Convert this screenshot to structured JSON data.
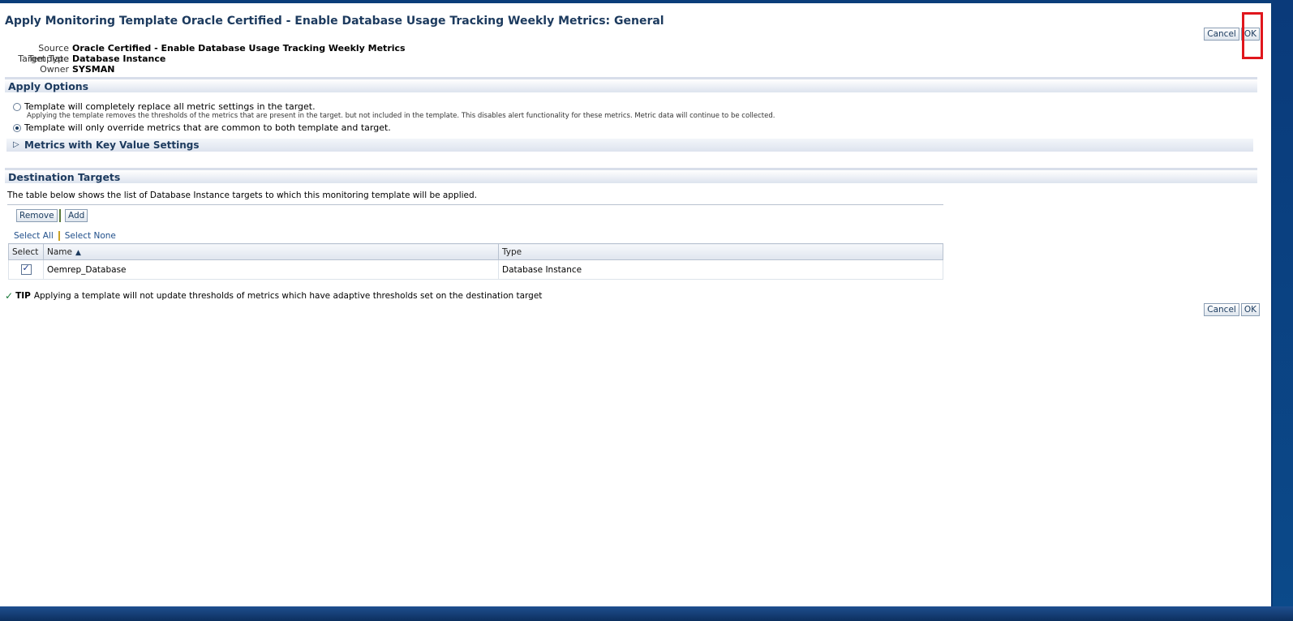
{
  "page": {
    "title": "Apply Monitoring Template Oracle Certified - Enable Database Usage Tracking Weekly Metrics: General"
  },
  "buttons": {
    "cancel": "Cancel",
    "ok": "OK",
    "remove": "Remove",
    "add": "Add"
  },
  "info": [
    {
      "label": "Source Template",
      "value": "Oracle Certified - Enable Database Usage Tracking Weekly Metrics"
    },
    {
      "label": "Target Type",
      "value": "Database Instance"
    },
    {
      "label": "Owner",
      "value": "SYSMAN"
    }
  ],
  "apply_options": {
    "heading": "Apply Options",
    "option1": "Template will completely replace all metric settings in the target.",
    "option1_note": "Applying the template removes the thresholds of the metrics that are present in the target. but not included in the template. This disables alert functionality for these metrics. Metric data will continue to be collected.",
    "option2": "Template will only override metrics that are common to both template and target.",
    "selected": "option2",
    "metrics_section": "Metrics with Key Value Settings"
  },
  "destination": {
    "heading": "Destination Targets",
    "description": "The table below shows the list of Database Instance targets to which this monitoring template will be applied.",
    "select_all": "Select All",
    "select_none": "Select None",
    "columns": {
      "select": "Select",
      "name": "Name",
      "type": "Type"
    },
    "rows": [
      {
        "name": "Oemrep_Database",
        "type": "Database Instance",
        "checked": true
      }
    ]
  },
  "tip": {
    "label": "TIP",
    "text": "Applying a template will not update thresholds of metrics which have adaptive thresholds set on the destination target"
  },
  "colors": {
    "highlight": "#e0161c",
    "heading": "#1c3a5e"
  }
}
